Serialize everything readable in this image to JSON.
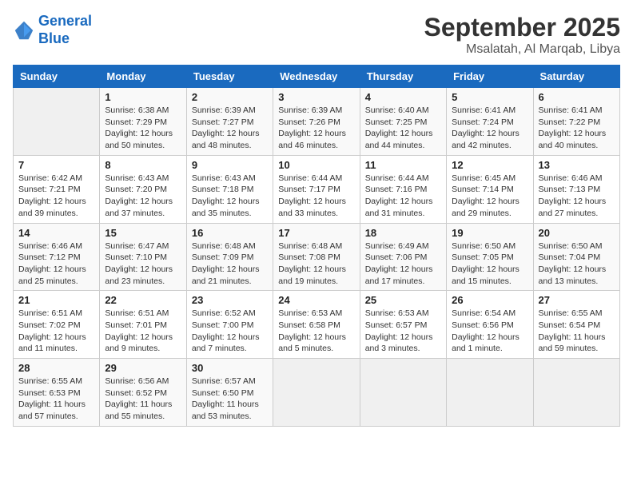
{
  "logo": {
    "line1": "General",
    "line2": "Blue"
  },
  "title": "September 2025",
  "location": "Msalatah, Al Marqab, Libya",
  "days_of_week": [
    "Sunday",
    "Monday",
    "Tuesday",
    "Wednesday",
    "Thursday",
    "Friday",
    "Saturday"
  ],
  "weeks": [
    [
      {
        "day": "",
        "sunrise": "",
        "sunset": "",
        "daylight": ""
      },
      {
        "day": "1",
        "sunrise": "Sunrise: 6:38 AM",
        "sunset": "Sunset: 7:29 PM",
        "daylight": "Daylight: 12 hours and 50 minutes."
      },
      {
        "day": "2",
        "sunrise": "Sunrise: 6:39 AM",
        "sunset": "Sunset: 7:27 PM",
        "daylight": "Daylight: 12 hours and 48 minutes."
      },
      {
        "day": "3",
        "sunrise": "Sunrise: 6:39 AM",
        "sunset": "Sunset: 7:26 PM",
        "daylight": "Daylight: 12 hours and 46 minutes."
      },
      {
        "day": "4",
        "sunrise": "Sunrise: 6:40 AM",
        "sunset": "Sunset: 7:25 PM",
        "daylight": "Daylight: 12 hours and 44 minutes."
      },
      {
        "day": "5",
        "sunrise": "Sunrise: 6:41 AM",
        "sunset": "Sunset: 7:24 PM",
        "daylight": "Daylight: 12 hours and 42 minutes."
      },
      {
        "day": "6",
        "sunrise": "Sunrise: 6:41 AM",
        "sunset": "Sunset: 7:22 PM",
        "daylight": "Daylight: 12 hours and 40 minutes."
      }
    ],
    [
      {
        "day": "7",
        "sunrise": "Sunrise: 6:42 AM",
        "sunset": "Sunset: 7:21 PM",
        "daylight": "Daylight: 12 hours and 39 minutes."
      },
      {
        "day": "8",
        "sunrise": "Sunrise: 6:43 AM",
        "sunset": "Sunset: 7:20 PM",
        "daylight": "Daylight: 12 hours and 37 minutes."
      },
      {
        "day": "9",
        "sunrise": "Sunrise: 6:43 AM",
        "sunset": "Sunset: 7:18 PM",
        "daylight": "Daylight: 12 hours and 35 minutes."
      },
      {
        "day": "10",
        "sunrise": "Sunrise: 6:44 AM",
        "sunset": "Sunset: 7:17 PM",
        "daylight": "Daylight: 12 hours and 33 minutes."
      },
      {
        "day": "11",
        "sunrise": "Sunrise: 6:44 AM",
        "sunset": "Sunset: 7:16 PM",
        "daylight": "Daylight: 12 hours and 31 minutes."
      },
      {
        "day": "12",
        "sunrise": "Sunrise: 6:45 AM",
        "sunset": "Sunset: 7:14 PM",
        "daylight": "Daylight: 12 hours and 29 minutes."
      },
      {
        "day": "13",
        "sunrise": "Sunrise: 6:46 AM",
        "sunset": "Sunset: 7:13 PM",
        "daylight": "Daylight: 12 hours and 27 minutes."
      }
    ],
    [
      {
        "day": "14",
        "sunrise": "Sunrise: 6:46 AM",
        "sunset": "Sunset: 7:12 PM",
        "daylight": "Daylight: 12 hours and 25 minutes."
      },
      {
        "day": "15",
        "sunrise": "Sunrise: 6:47 AM",
        "sunset": "Sunset: 7:10 PM",
        "daylight": "Daylight: 12 hours and 23 minutes."
      },
      {
        "day": "16",
        "sunrise": "Sunrise: 6:48 AM",
        "sunset": "Sunset: 7:09 PM",
        "daylight": "Daylight: 12 hours and 21 minutes."
      },
      {
        "day": "17",
        "sunrise": "Sunrise: 6:48 AM",
        "sunset": "Sunset: 7:08 PM",
        "daylight": "Daylight: 12 hours and 19 minutes."
      },
      {
        "day": "18",
        "sunrise": "Sunrise: 6:49 AM",
        "sunset": "Sunset: 7:06 PM",
        "daylight": "Daylight: 12 hours and 17 minutes."
      },
      {
        "day": "19",
        "sunrise": "Sunrise: 6:50 AM",
        "sunset": "Sunset: 7:05 PM",
        "daylight": "Daylight: 12 hours and 15 minutes."
      },
      {
        "day": "20",
        "sunrise": "Sunrise: 6:50 AM",
        "sunset": "Sunset: 7:04 PM",
        "daylight": "Daylight: 12 hours and 13 minutes."
      }
    ],
    [
      {
        "day": "21",
        "sunrise": "Sunrise: 6:51 AM",
        "sunset": "Sunset: 7:02 PM",
        "daylight": "Daylight: 12 hours and 11 minutes."
      },
      {
        "day": "22",
        "sunrise": "Sunrise: 6:51 AM",
        "sunset": "Sunset: 7:01 PM",
        "daylight": "Daylight: 12 hours and 9 minutes."
      },
      {
        "day": "23",
        "sunrise": "Sunrise: 6:52 AM",
        "sunset": "Sunset: 7:00 PM",
        "daylight": "Daylight: 12 hours and 7 minutes."
      },
      {
        "day": "24",
        "sunrise": "Sunrise: 6:53 AM",
        "sunset": "Sunset: 6:58 PM",
        "daylight": "Daylight: 12 hours and 5 minutes."
      },
      {
        "day": "25",
        "sunrise": "Sunrise: 6:53 AM",
        "sunset": "Sunset: 6:57 PM",
        "daylight": "Daylight: 12 hours and 3 minutes."
      },
      {
        "day": "26",
        "sunrise": "Sunrise: 6:54 AM",
        "sunset": "Sunset: 6:56 PM",
        "daylight": "Daylight: 12 hours and 1 minute."
      },
      {
        "day": "27",
        "sunrise": "Sunrise: 6:55 AM",
        "sunset": "Sunset: 6:54 PM",
        "daylight": "Daylight: 11 hours and 59 minutes."
      }
    ],
    [
      {
        "day": "28",
        "sunrise": "Sunrise: 6:55 AM",
        "sunset": "Sunset: 6:53 PM",
        "daylight": "Daylight: 11 hours and 57 minutes."
      },
      {
        "day": "29",
        "sunrise": "Sunrise: 6:56 AM",
        "sunset": "Sunset: 6:52 PM",
        "daylight": "Daylight: 11 hours and 55 minutes."
      },
      {
        "day": "30",
        "sunrise": "Sunrise: 6:57 AM",
        "sunset": "Sunset: 6:50 PM",
        "daylight": "Daylight: 11 hours and 53 minutes."
      },
      {
        "day": "",
        "sunrise": "",
        "sunset": "",
        "daylight": ""
      },
      {
        "day": "",
        "sunrise": "",
        "sunset": "",
        "daylight": ""
      },
      {
        "day": "",
        "sunrise": "",
        "sunset": "",
        "daylight": ""
      },
      {
        "day": "",
        "sunrise": "",
        "sunset": "",
        "daylight": ""
      }
    ]
  ]
}
